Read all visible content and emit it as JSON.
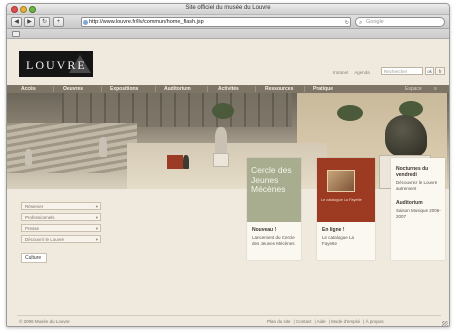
{
  "window": {
    "title": "Site officiel du musée du Louvre"
  },
  "toolbar": {
    "back": "◀",
    "forward": "▶",
    "reload": "↻",
    "add": "+",
    "url": "http://www.louvre.fr/llv/commun/home_flash.jsp",
    "search_placeholder": "Google"
  },
  "header": {
    "logo_text": "LOUVRE",
    "util_links": [
      "Intranet",
      "Agenda"
    ],
    "search_placeholder": "Rechercher",
    "ok_label": "ok",
    "lang_label": "fr"
  },
  "nav": {
    "items": [
      "Accès",
      "Oeuvres",
      "Expositions",
      "Auditorium",
      "Activités",
      "Ressources",
      "Pratique"
    ],
    "extras": [
      "Espace",
      "≡"
    ]
  },
  "sidebar": {
    "selects": [
      "Réserver",
      "Professionnels",
      "Presse",
      "Découvrir le Louvre"
    ],
    "culture_label": "Culture"
  },
  "cards": {
    "cercle": {
      "box_text": "Cercle des Jeunes Mécènes",
      "title": "Nouveau !",
      "text": "Lancement du Cercle des Jeunes Mécènes"
    },
    "book": {
      "box_text": "Le catalogue La Fayette",
      "title": "En ligne !",
      "text": "Le catalogue La Fayette"
    },
    "info": {
      "title1": "Nocturnes du vendredi",
      "text1": "Découvrez le Louvre autrement",
      "title2": "Auditorium",
      "text2": "Saison Musique 2006-2007"
    }
  },
  "footer": {
    "copyright": "© 2006 Musée du Louvre",
    "links": [
      "Plan du site",
      "Contact",
      "Aide",
      "Mode d'emploi",
      "À propos"
    ]
  }
}
